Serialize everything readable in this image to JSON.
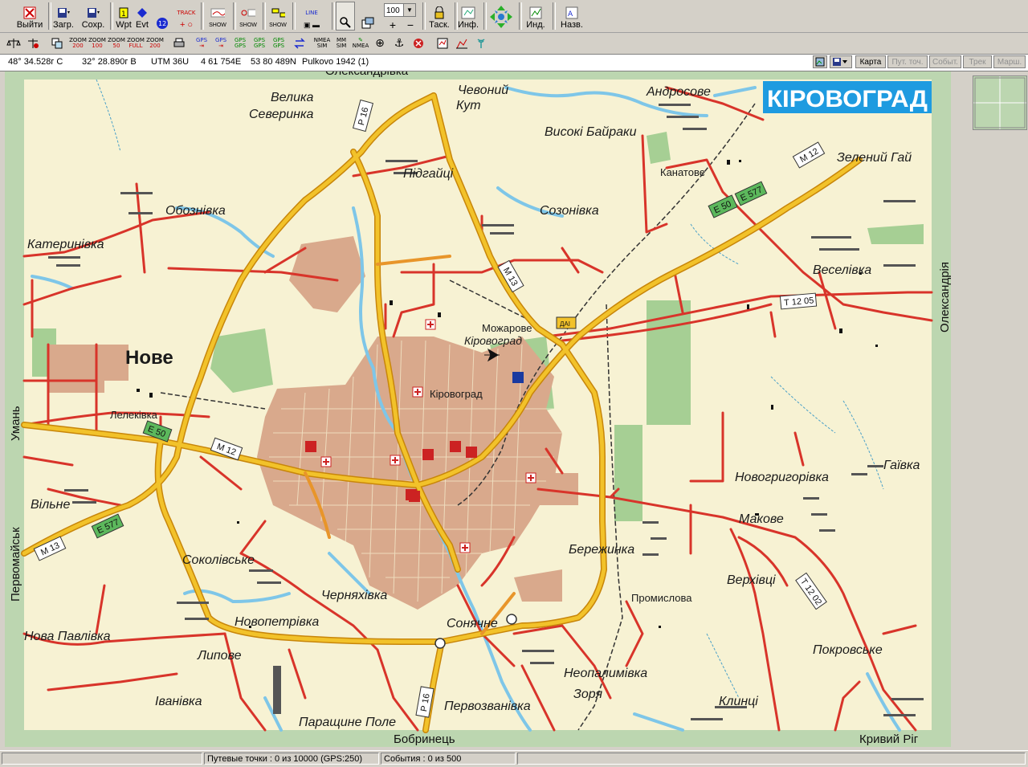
{
  "toolbar_main": [
    {
      "name": "exit",
      "label": "Выйти",
      "icon": "exit-icon"
    },
    {
      "name": "load",
      "label": "Загр.",
      "icon": "load-icon"
    },
    {
      "name": "save",
      "label": "Сохр.",
      "icon": "save-icon"
    },
    {
      "name": "wpt",
      "label": "Wpt",
      "icon": "waypoint-icon"
    },
    {
      "name": "evt",
      "label": "Evt",
      "icon": "event-icon"
    },
    {
      "name": "track",
      "label": "TRACK",
      "icon": "track-icon"
    },
    {
      "name": "show1",
      "label": "SHOW",
      "icon": "show-icon"
    },
    {
      "name": "show2",
      "label": "SHOW",
      "icon": "show-icon"
    },
    {
      "name": "show3",
      "label": "SHOW",
      "icon": "show-icon"
    },
    {
      "name": "line",
      "label": "LINE",
      "icon": "line-icon"
    },
    {
      "name": "task",
      "label": "Таск.",
      "icon": "lock-icon"
    },
    {
      "name": "info",
      "label": "Инф.",
      "icon": "info-icon"
    },
    {
      "name": "ind",
      "label": "Инд.",
      "icon": "indicator-icon"
    },
    {
      "name": "names",
      "label": "Назв.",
      "icon": "names-icon"
    }
  ],
  "zoom_value": "100",
  "toolbar_second": [
    {
      "top": "ZOOM",
      "bottom": "200"
    },
    {
      "top": "ZOOM",
      "bottom": "100"
    },
    {
      "top": "ZOOM",
      "bottom": "50"
    },
    {
      "top": "ZOOM",
      "bottom": "FULL"
    },
    {
      "top": "ZOOM",
      "bottom": "200"
    },
    {
      "top": "GPS",
      "bottom": "⇥"
    },
    {
      "top": "GPS",
      "bottom": "⇥"
    },
    {
      "top": "GPS",
      "bottom": "GPS"
    },
    {
      "top": "GPS",
      "bottom": "GPS"
    },
    {
      "top": "GPS",
      "bottom": "GPS"
    },
    {
      "top": "NMEA",
      "bottom": "SIM"
    },
    {
      "top": "MM",
      "bottom": "SIM"
    },
    {
      "top": "",
      "bottom": "NMEA"
    }
  ],
  "coords": {
    "lat": "48° 34.528г С",
    "lon": "32° 28.890г В",
    "utm_zone": "UTM  36U",
    "easting": "4 61 754E",
    "northing": "53 80 489N",
    "datum": "Pulkovo 1942 (1)"
  },
  "right_buttons": [
    {
      "label": "Карта",
      "enabled": true
    },
    {
      "label": "Пут. точ.",
      "enabled": false
    },
    {
      "label": "Событ.",
      "enabled": false
    },
    {
      "label": "Трек",
      "enabled": false
    },
    {
      "label": "Марш.",
      "enabled": false
    }
  ],
  "map": {
    "title": "КІРОВОГРАД",
    "edge_labels": {
      "top": "Олександрівка",
      "right": "Олександрія",
      "left_top": "Умань",
      "left_bottom": "Первомайськ",
      "bottom": "Бобринець",
      "bottom_right": "Кривий Ріг"
    },
    "places": [
      {
        "name": "Велика",
        "cls": "it"
      },
      {
        "name": "Северинка",
        "cls": "it"
      },
      {
        "name": "Чевоний",
        "cls": "it"
      },
      {
        "name": "Кут",
        "cls": "it"
      },
      {
        "name": "Андросове",
        "cls": "it"
      },
      {
        "name": "Високі  Байраки",
        "cls": "it"
      },
      {
        "name": "Зелений  Гай",
        "cls": "it"
      },
      {
        "name": "Канатове",
        "cls": "sm"
      },
      {
        "name": "Підгайці",
        "cls": "it"
      },
      {
        "name": "Созонівка",
        "cls": "it"
      },
      {
        "name": "Обознівка",
        "cls": "it"
      },
      {
        "name": "Катеринівка",
        "cls": "it"
      },
      {
        "name": "Веселівка",
        "cls": "it"
      },
      {
        "name": "Можарове",
        "cls": "sm"
      },
      {
        "name": "Кіровоград",
        "cls": "it"
      },
      {
        "name": "Нове",
        "cls": "big"
      },
      {
        "name": "Кіровоград",
        "cls": "sm"
      },
      {
        "name": "Лелеківка",
        "cls": "sm"
      },
      {
        "name": "Вільне",
        "cls": "it"
      },
      {
        "name": "Новогригорівка",
        "cls": "it"
      },
      {
        "name": "Гаївка",
        "cls": "it"
      },
      {
        "name": "Макове",
        "cls": "it"
      },
      {
        "name": "Бережинка",
        "cls": "it"
      },
      {
        "name": "Соколівське",
        "cls": "it"
      },
      {
        "name": "Верхівці",
        "cls": "it"
      },
      {
        "name": "Черняхівка",
        "cls": "it"
      },
      {
        "name": "Промислова",
        "cls": "sm"
      },
      {
        "name": "Новопетрівка",
        "cls": "it"
      },
      {
        "name": "Сонячне",
        "cls": "it"
      },
      {
        "name": "Нова  Павлівка",
        "cls": "it"
      },
      {
        "name": "Покровське",
        "cls": "it"
      },
      {
        "name": "Липове",
        "cls": "it"
      },
      {
        "name": "Неопалимівка",
        "cls": "it"
      },
      {
        "name": "Зоря",
        "cls": "it"
      },
      {
        "name": "Іванівка",
        "cls": "it"
      },
      {
        "name": "Клинці",
        "cls": "it"
      },
      {
        "name": "Паращине Поле",
        "cls": "it"
      },
      {
        "name": "Первозванівка",
        "cls": "it"
      }
    ],
    "road_labels": [
      "Р 16",
      "М 12",
      "Е 50",
      "Е 577",
      "М 13",
      "Т 12 05",
      "Т 12 02",
      "М 12",
      "Е 50",
      "Е 577",
      "М 13",
      "Р 16",
      "ДАІ"
    ],
    "colors": {
      "land": "#f7f2d3",
      "city": "#d9a98c",
      "forest": "#a6cf94",
      "water": "#7ec6e8",
      "main_road": "#f2c22a",
      "red_road": "#d8342a",
      "road_outline": "#c8860a"
    }
  },
  "status": {
    "waypoints": "Путевые точки : 0 из 10000  (GPS:250)",
    "events": "События : 0 из 500"
  }
}
